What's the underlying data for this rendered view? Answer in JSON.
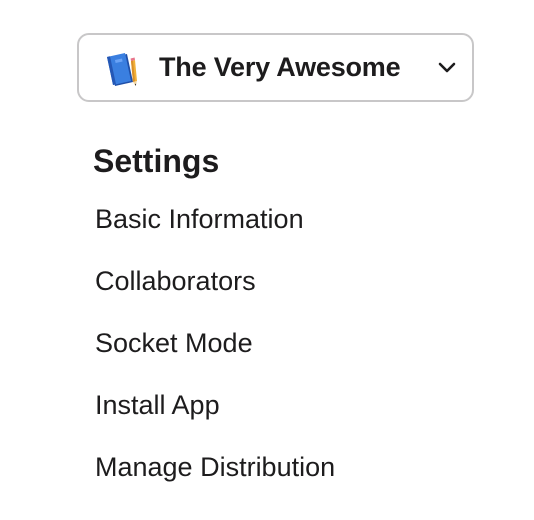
{
  "app_selector": {
    "icon": "blue-notebook-pencil-icon",
    "name": "The Very Awesome",
    "chevron_icon": "chevron-down-icon"
  },
  "settings": {
    "heading": "Settings",
    "items": [
      {
        "label": "Basic Information"
      },
      {
        "label": "Collaborators"
      },
      {
        "label": "Socket Mode"
      },
      {
        "label": "Install App"
      },
      {
        "label": "Manage Distribution"
      }
    ]
  },
  "colors": {
    "text": "#1d1c1d",
    "border": "#c8c7c8",
    "icon_blue": "#2f6fd1",
    "pencil": "#f2b13a"
  }
}
